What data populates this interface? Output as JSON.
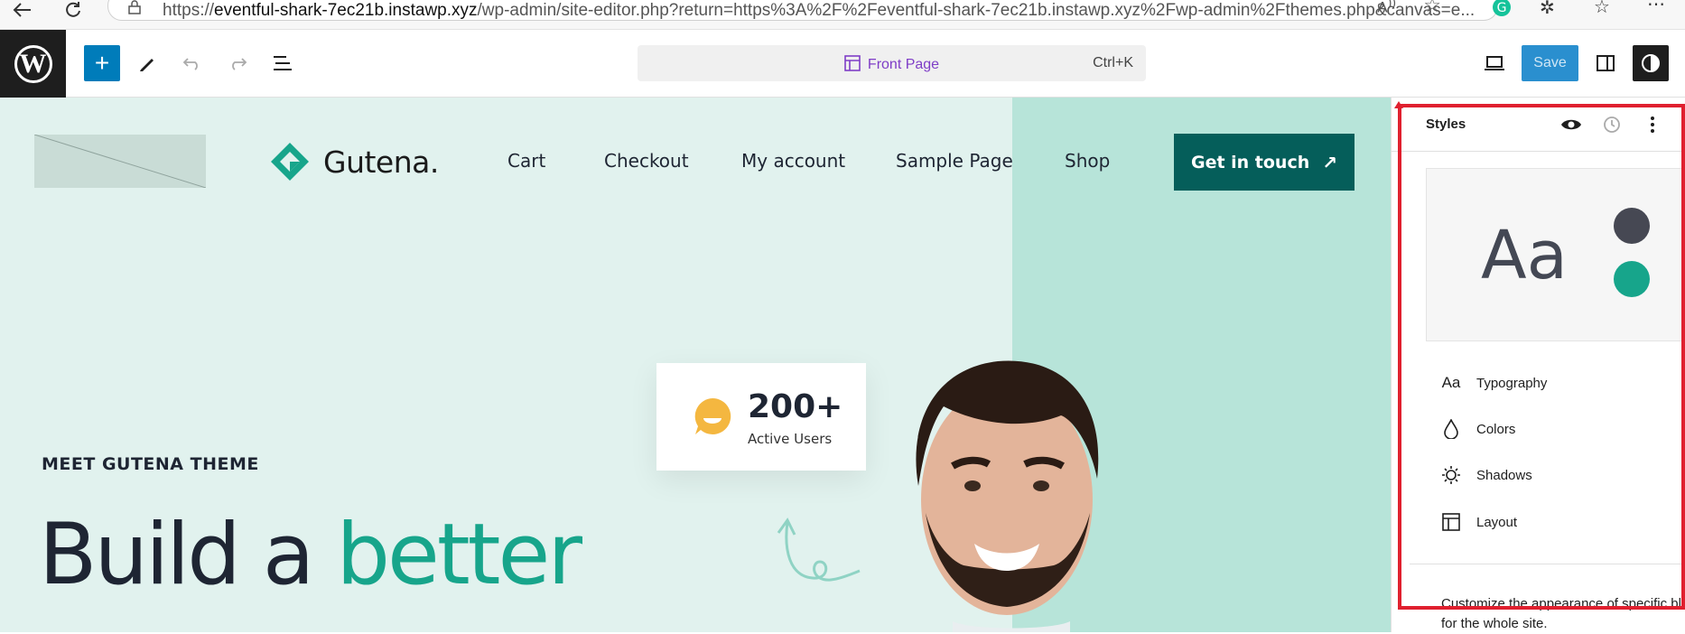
{
  "browser": {
    "url_prefix": "https://",
    "url_host": "eventful-shark-7ec21b.instawp.xyz",
    "url_path": "/wp-admin/site-editor.php?return=https%3A%2F%2Feventful-shark-7ec21b.instawp.xyz%2Fwp-admin%2Fthemes.php&canvas=e..."
  },
  "toolbar": {
    "add_label": "+",
    "document_title": "Front Page",
    "shortcut": "Ctrl+K",
    "save_label": "Save"
  },
  "site": {
    "brand_name": "Gutena.",
    "nav": [
      "Cart",
      "Checkout",
      "My account",
      "Sample Page",
      "Shop"
    ],
    "cta_label": "Get in touch",
    "users_count": "200+",
    "users_label": "Active Users",
    "eyebrow": "MEET GUTENA THEME",
    "headline_start": "Build a ",
    "headline_accent": "better"
  },
  "styles_panel": {
    "title": "Styles",
    "preview_text": "Aa",
    "preview_colors": [
      "#464853",
      "#17a58b"
    ],
    "items": [
      {
        "label": "Typography",
        "icon": "typography-icon",
        "glyph": "Aa"
      },
      {
        "label": "Colors",
        "icon": "droplet-icon"
      },
      {
        "label": "Shadows",
        "icon": "shadow-icon"
      },
      {
        "label": "Layout",
        "icon": "layout-icon"
      }
    ],
    "description": "Customize the appearance of specific blocks for the whole site."
  },
  "colors": {
    "accent": "#007cba",
    "brand": "#055e5a",
    "headline_accent": "#17a58b",
    "highlight": "#e0202f"
  }
}
